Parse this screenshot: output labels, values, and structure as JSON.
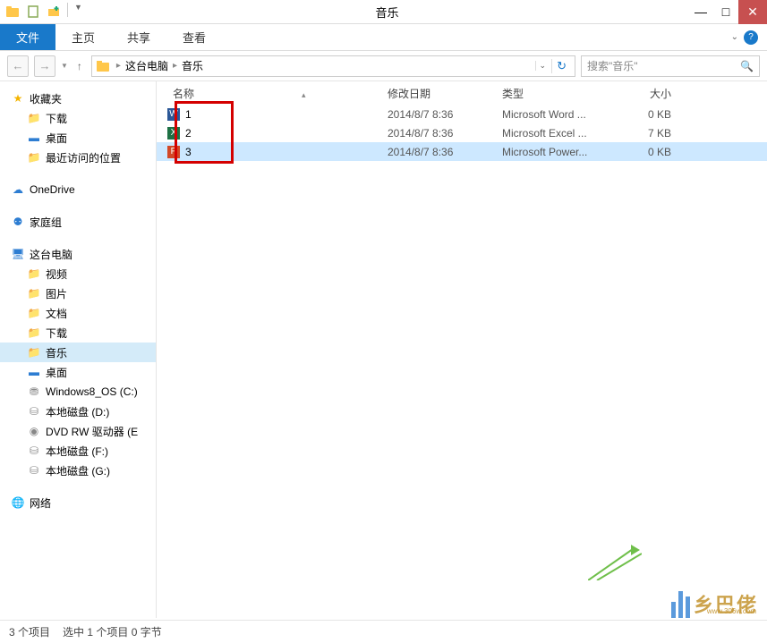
{
  "window": {
    "title": "音乐"
  },
  "ribbon": {
    "file": "文件",
    "tabs": [
      "主页",
      "共享",
      "查看"
    ]
  },
  "nav": {
    "path": [
      "这台电脑",
      "音乐"
    ],
    "search_placeholder": "搜索\"音乐\""
  },
  "columns": {
    "name": "名称",
    "date": "修改日期",
    "type": "类型",
    "size": "大小"
  },
  "files": [
    {
      "name": "1",
      "date": "2014/8/7 8:36",
      "type": "Microsoft Word ...",
      "size": "0 KB",
      "app": "word",
      "sel": false
    },
    {
      "name": "2",
      "date": "2014/8/7 8:36",
      "type": "Microsoft Excel ...",
      "size": "7 KB",
      "app": "excel",
      "sel": false
    },
    {
      "name": "3",
      "date": "2014/8/7 8:36",
      "type": "Microsoft Power...",
      "size": "0 KB",
      "app": "ppt",
      "sel": true
    }
  ],
  "tree": {
    "fav": "收藏夹",
    "fav_items": [
      "下载",
      "桌面",
      "最近访问的位置"
    ],
    "onedrive": "OneDrive",
    "homegroup": "家庭组",
    "pc": "这台电脑",
    "pc_items": [
      "视频",
      "图片",
      "文档",
      "下载",
      "音乐",
      "桌面",
      "Windows8_OS (C:)",
      "本地磁盘 (D:)",
      "DVD RW 驱动器 (E",
      "本地磁盘 (F:)",
      "本地磁盘 (G:)"
    ],
    "network": "网络"
  },
  "status": {
    "count": "3 个项目",
    "sel": "选中 1 个项目 0 字节"
  },
  "watermark": {
    "text": "乡巴佬",
    "url": "www.306w.com"
  }
}
